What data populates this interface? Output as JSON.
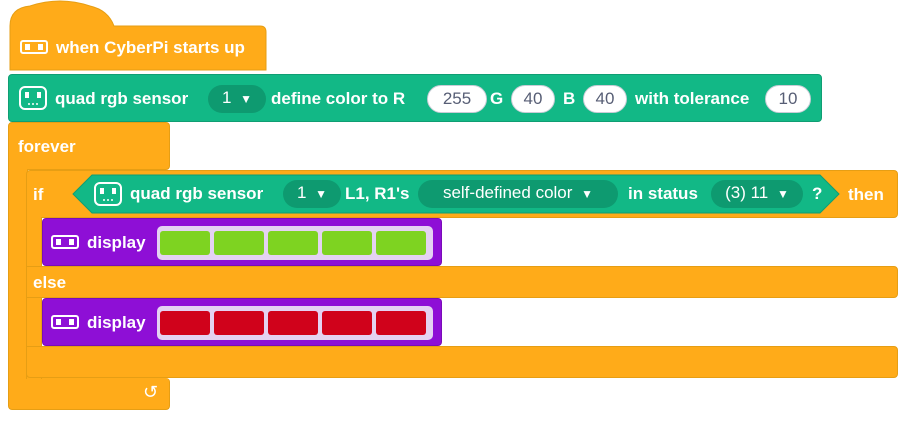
{
  "colors": {
    "control": "#ffab19",
    "sensor": "#12b886",
    "display": "#8e0fd6",
    "led_green": "#7ed321",
    "led_red": "#d0021b"
  },
  "hat_block": {
    "label": "when CyberPi starts up",
    "icon": "cyberpi-icon"
  },
  "define_block": {
    "prefix": "quad rgb sensor",
    "sensor_id": "1",
    "text_define": "define color to R",
    "r_value": "255",
    "text_g": "G",
    "g_value": "40",
    "text_b": "B",
    "b_value": "40",
    "text_tolerance": "with tolerance",
    "tolerance_value": "10",
    "icon": "sensor-icon"
  },
  "forever_block": {
    "label": "forever",
    "loop_icon": "loop-arrow-icon"
  },
  "if_block": {
    "label_if": "if",
    "label_then": "then",
    "label_else": "else",
    "condition": {
      "prefix": "quad rgb sensor",
      "sensor_id": "1",
      "text_probes": "L1, R1's",
      "color_option": "self-defined color",
      "text_status": "in status",
      "status_option": "(3) 11",
      "suffix": "?",
      "icon": "sensor-icon"
    }
  },
  "display_blocks": [
    {
      "label": "display",
      "icon": "cyberpi-icon",
      "leds": [
        "green",
        "green",
        "green",
        "green",
        "green"
      ]
    },
    {
      "label": "display",
      "icon": "cyberpi-icon",
      "leds": [
        "red",
        "red",
        "red",
        "red",
        "red"
      ]
    }
  ]
}
